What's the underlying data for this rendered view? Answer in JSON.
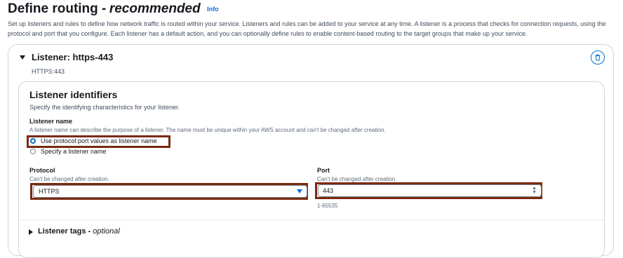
{
  "header": {
    "title_main": "Define routing -",
    "title_emphasis": "recommended",
    "info_link": "Info",
    "description": "Set up listeners and rules to define how network traffic is routed within your service. Listeners and rules can be added to your service at any time. A listener is a process that checks for connection requests, using the protocol and port that you configure. Each listener has a default action, and you can optionally define rules to enable content-based routing to the target groups that make up your service."
  },
  "listener": {
    "title": "Listener: https-443",
    "subtitle": "HTTPS:443",
    "delete_icon": "trash-icon",
    "identifiers": {
      "title": "Listener identifiers",
      "description": "Specify the identifying characteristics for your listener.",
      "name_label": "Listener name",
      "name_hint": "A listener name can describe the purpose of a listener. The name must be unique within your AWS account and can't be changed after creation.",
      "option_protocol_port": "Use protocol:port values as listener name",
      "option_specify": "Specify a listener name",
      "selected_option": "Use protocol:port values as listener name",
      "protocol_label": "Protocol",
      "protocol_hint": "Can't be changed after creation.",
      "protocol_value": "HTTPS",
      "port_label": "Port",
      "port_hint": "Can't be changed after creation.",
      "port_value": "443",
      "port_range": "1-65535"
    },
    "tags": {
      "label": "Listener tags -",
      "optional": "optional"
    }
  },
  "colors": {
    "accent": "#0972d3",
    "highlight": "#7a2a0e",
    "text": "#16191f"
  }
}
